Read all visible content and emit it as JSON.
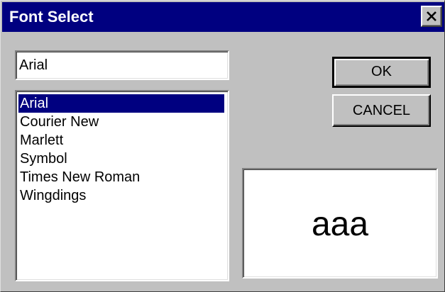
{
  "window": {
    "title": "Font Select"
  },
  "font_input": {
    "value": "Arial"
  },
  "font_list": {
    "items": [
      {
        "label": "Arial",
        "selected": true
      },
      {
        "label": "Courier New",
        "selected": false
      },
      {
        "label": "Marlett",
        "selected": false
      },
      {
        "label": "Symbol",
        "selected": false
      },
      {
        "label": "Times New Roman",
        "selected": false
      },
      {
        "label": "Wingdings",
        "selected": false
      }
    ]
  },
  "buttons": {
    "ok_label": "OK",
    "cancel_label": "CANCEL"
  },
  "preview": {
    "text": "aaa"
  },
  "colors": {
    "titlebar": "#000080",
    "face": "#c0c0c0",
    "selection": "#000080"
  },
  "icons": {
    "close": "close-icon"
  }
}
